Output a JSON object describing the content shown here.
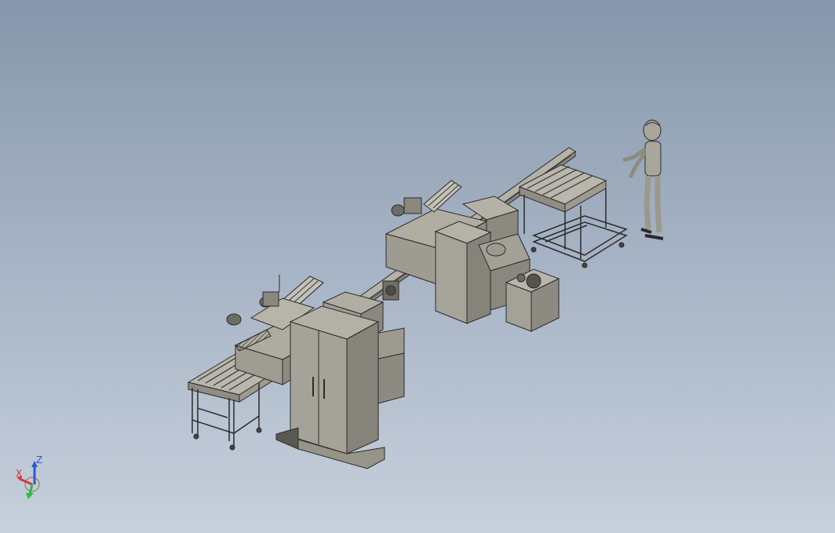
{
  "viewport": {
    "background_top": "#8797ab",
    "background_bottom": "#c7d0dc",
    "model_fill": "#a7a49a",
    "model_stroke": "#2b2b2b"
  },
  "scene": {
    "components": [
      "left-roller-conveyor",
      "left-feeder-machine",
      "electrical-cabinet",
      "linking-rail",
      "right-feeder-machine",
      "right-control-box",
      "coolant-tank",
      "right-roller-conveyor",
      "human-figure"
    ]
  },
  "triad": {
    "x_label": "X",
    "z_label": "Z",
    "x_color": "#d63a3a",
    "y_color": "#2fb84a",
    "z_color": "#2b57d6"
  }
}
